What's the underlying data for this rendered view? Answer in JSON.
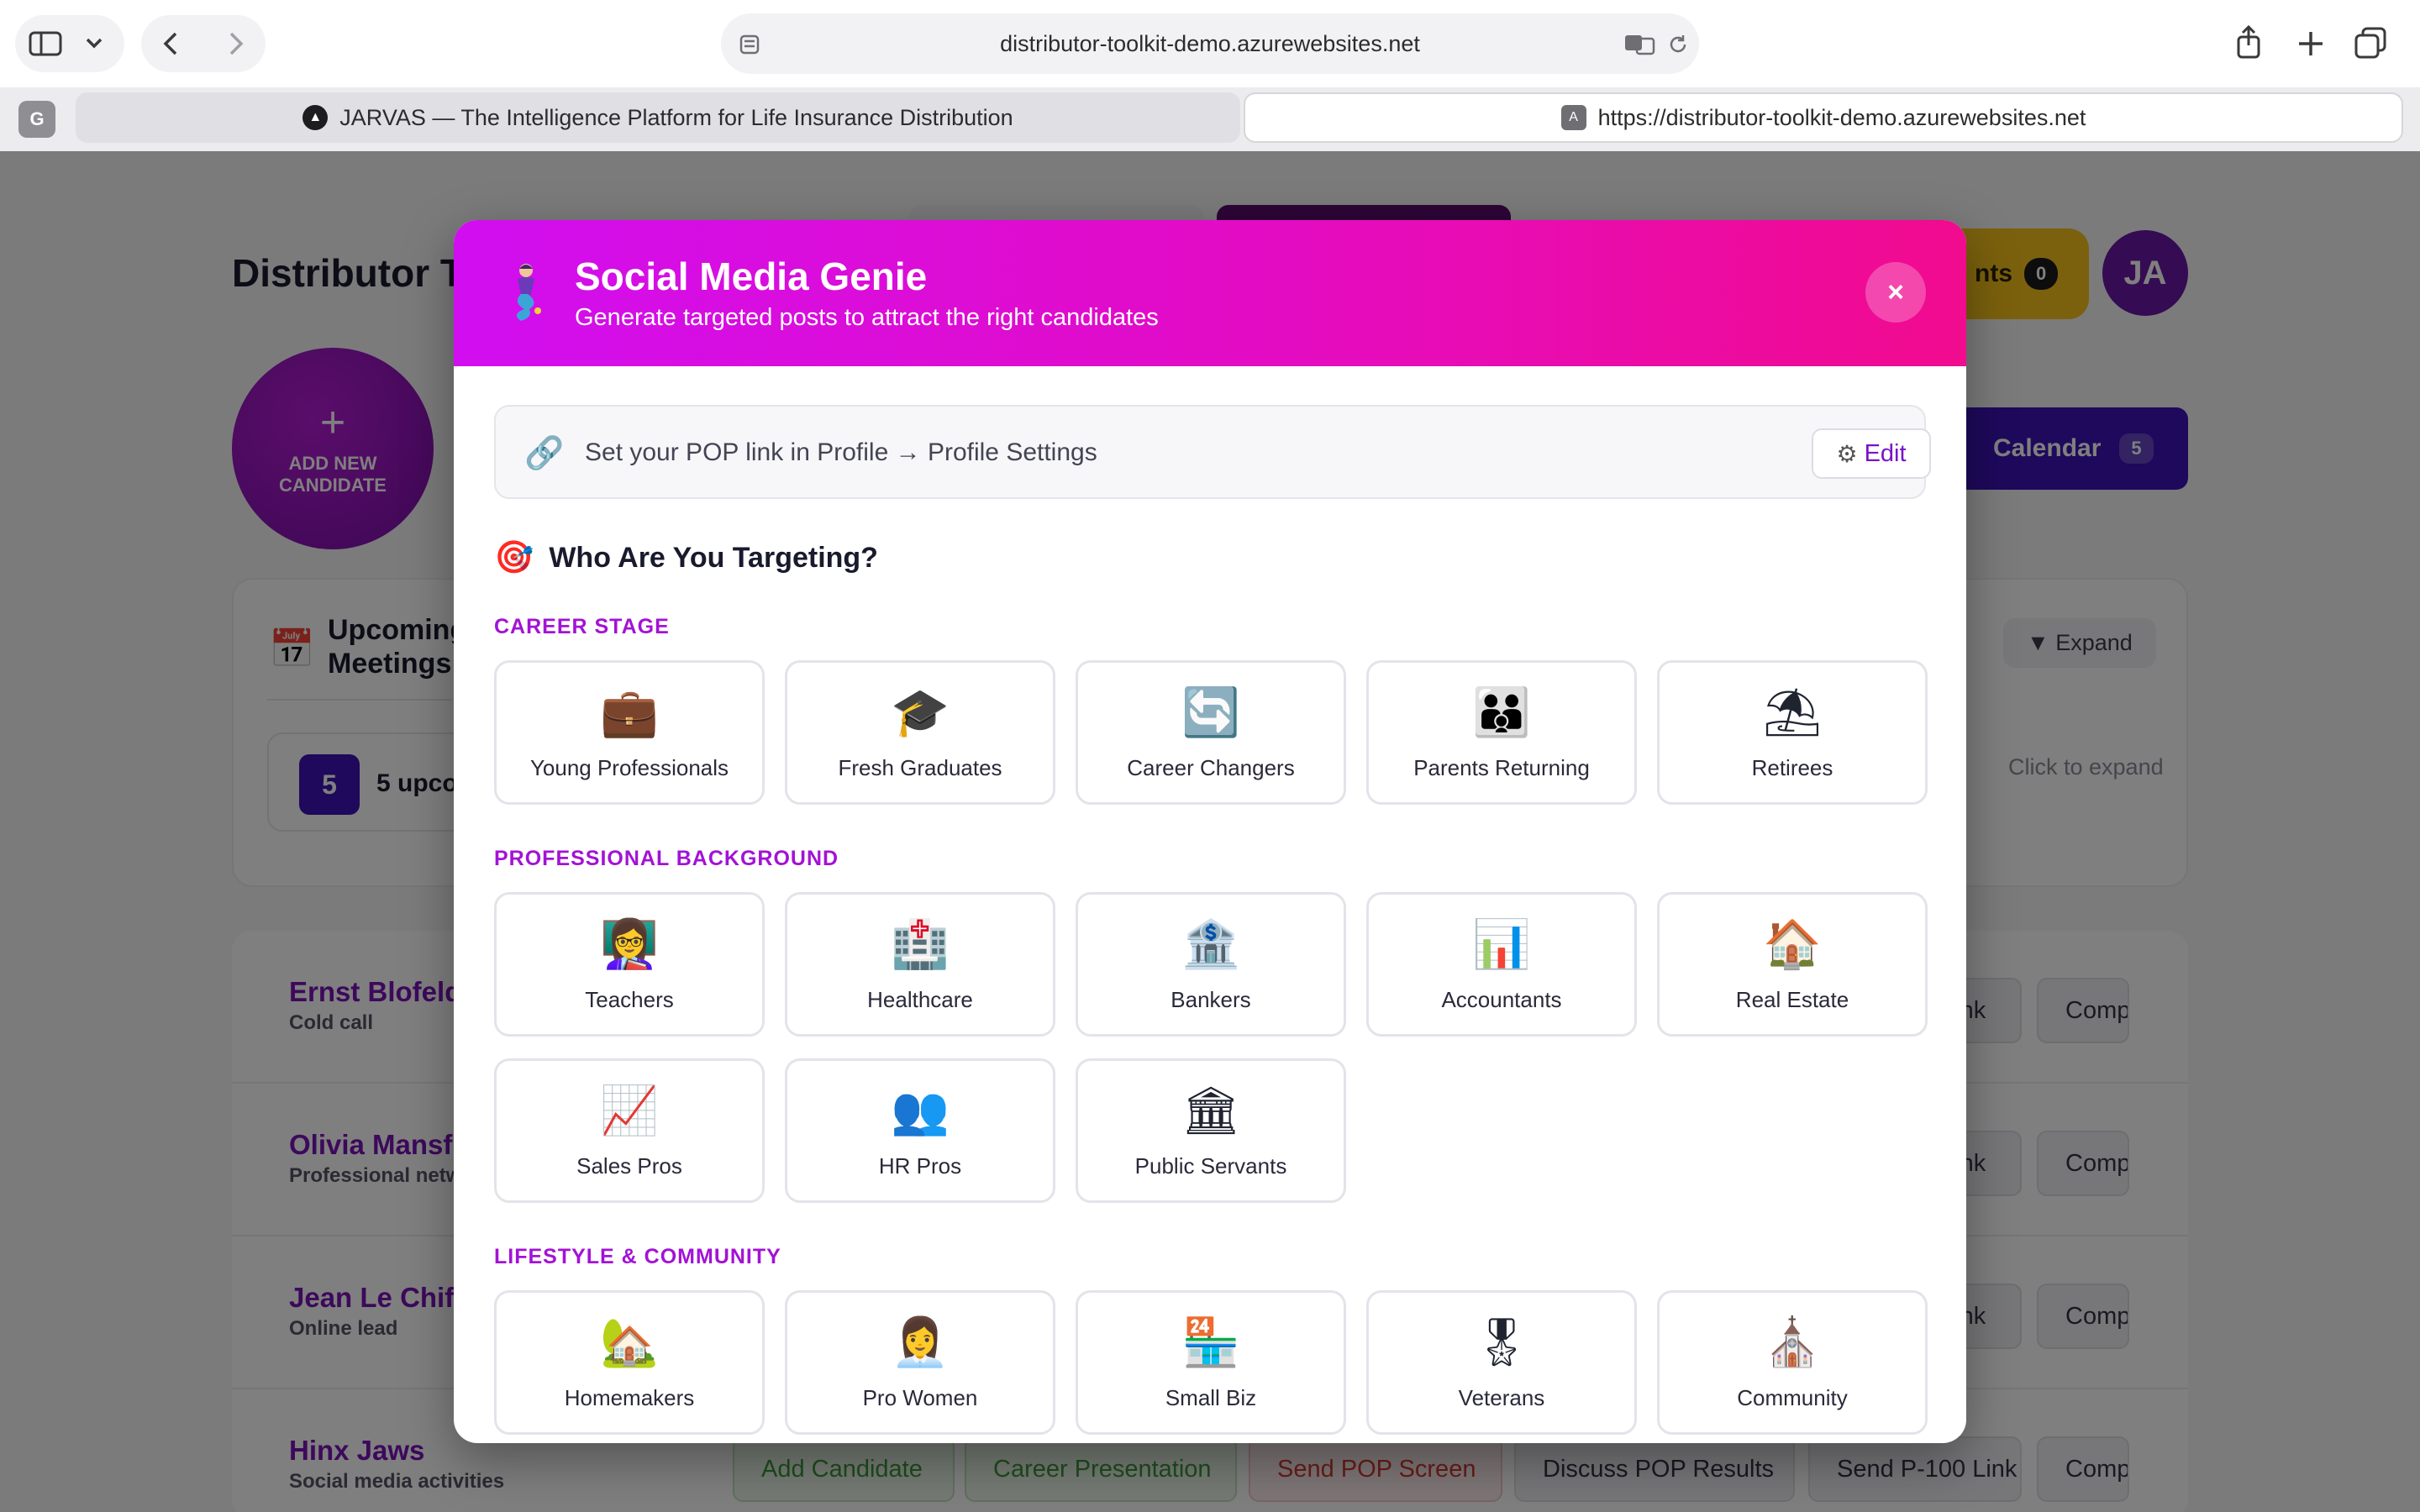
{
  "browser": {
    "url": "distributor-toolkit-demo.azurewebsites.net",
    "tabs": [
      {
        "label": "JARVAS — The Intelligence Platform for Life Insurance Distribution"
      },
      {
        "label": "https://distributor-toolkit-demo.azurewebsites.net"
      }
    ],
    "tab_group_label": "G"
  },
  "app": {
    "title": "Distributor T",
    "add_candidate": {
      "plus": "+",
      "label": "ADD NEW CANDIDATE"
    },
    "notifications": {
      "label": "nts",
      "count": "0"
    },
    "avatar": "JA",
    "calendar": {
      "label": "Calendar",
      "count": "5"
    },
    "meetings_card": {
      "icon": "calendar-icon",
      "title": "Upcoming Meetings",
      "badge": "5",
      "summary": "5 upco",
      "expand": "▼ Expand",
      "click_to_expand": "Click to expand"
    },
    "rows": [
      {
        "name": "Ernst Blofeld",
        "sub": "Cold call",
        "btn1": "Link",
        "btn2": "Comp"
      },
      {
        "name": "Olivia Mansfi",
        "sub": "Professional netw",
        "btn1": "Link",
        "btn2": "Comp"
      },
      {
        "name": "Jean Le Chiff",
        "sub": "Online lead",
        "btn1": "Link",
        "btn2": "Comp"
      },
      {
        "name": "Hinx Jaws",
        "sub": "Social media activities",
        "btn1": "Send P-100 Link",
        "btn2": "Comp"
      }
    ],
    "row_actions": [
      "Add Candidate",
      "Career Presentation",
      "Send POP Screen",
      "Discuss POP Results"
    ]
  },
  "modal": {
    "title": "Social Media Genie",
    "subtitle": "Generate targeted posts to attract the right candidates",
    "close": "×",
    "pop_banner": {
      "text": "Set your POP link in Profile → Profile Settings",
      "edit": "Edit"
    },
    "targeting_heading": "Who Are You Targeting?",
    "sections": [
      {
        "label": "CAREER STAGE",
        "options": [
          {
            "emoji": "💼",
            "label": "Young Professionals"
          },
          {
            "emoji": "🎓",
            "label": "Fresh Graduates"
          },
          {
            "emoji": "🔄",
            "label": "Career Changers"
          },
          {
            "emoji": "👪",
            "label": "Parents Returning"
          },
          {
            "emoji": "⛱",
            "label": "Retirees"
          }
        ]
      },
      {
        "label": "PROFESSIONAL BACKGROUND",
        "options": [
          {
            "emoji": "👩‍🏫",
            "label": "Teachers"
          },
          {
            "emoji": "🏥",
            "label": "Healthcare"
          },
          {
            "emoji": "🏦",
            "label": "Bankers"
          },
          {
            "emoji": "📊",
            "label": "Accountants"
          },
          {
            "emoji": "🏠",
            "label": "Real Estate"
          },
          {
            "emoji": "📈",
            "label": "Sales Pros"
          },
          {
            "emoji": "👥",
            "label": "HR Pros"
          },
          {
            "emoji": "🏛",
            "label": "Public Servants"
          }
        ]
      },
      {
        "label": "LIFESTYLE & COMMUNITY",
        "options": [
          {
            "emoji": "🏡",
            "label": "Homemakers"
          },
          {
            "emoji": "👩‍💼",
            "label": "Pro Women"
          },
          {
            "emoji": "🏪",
            "label": "Small Biz"
          },
          {
            "emoji": "🎖",
            "label": "Veterans"
          },
          {
            "emoji": "⛪",
            "label": "Community"
          }
        ]
      }
    ]
  }
}
